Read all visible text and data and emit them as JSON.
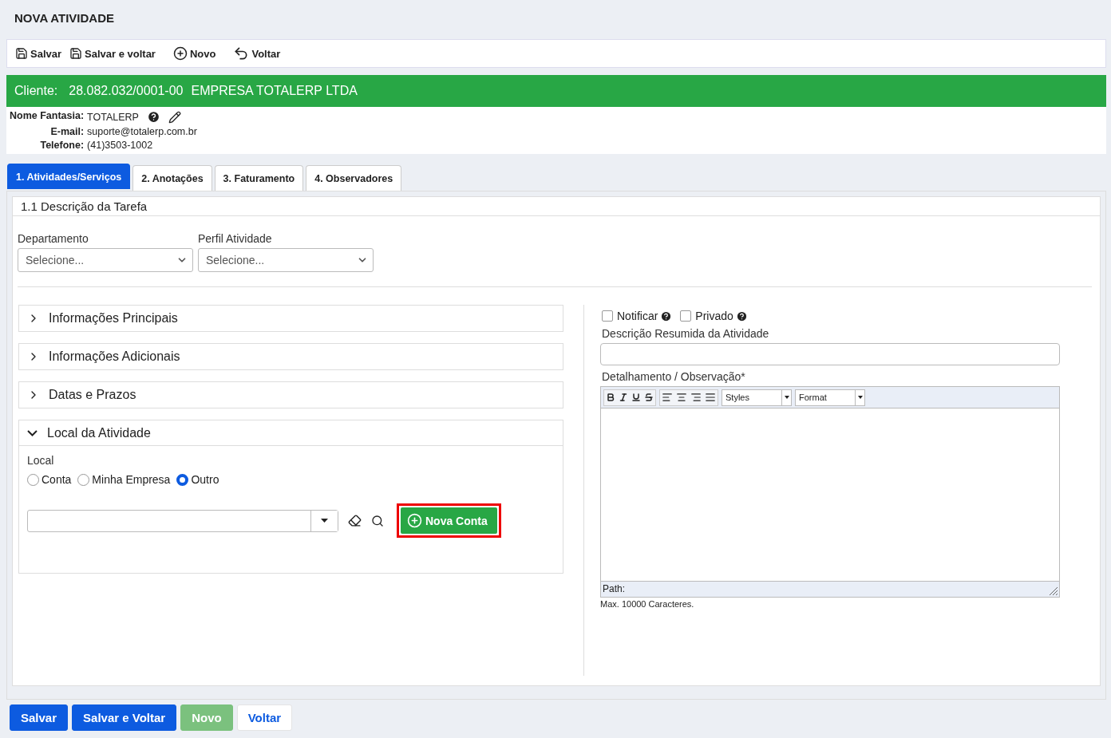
{
  "page_title": "NOVA ATIVIDADE",
  "toolbar": [
    {
      "label": "Salvar",
      "kind": "save"
    },
    {
      "label": "Salvar e voltar",
      "kind": "save"
    },
    {
      "label": "Novo",
      "kind": "new"
    },
    {
      "label": "Voltar",
      "kind": "back"
    }
  ],
  "client": {
    "label": "Cliente:",
    "document": "28.082.032/0001-00",
    "name": "EMPRESA TOTALERP LTDA"
  },
  "details": [
    {
      "label": "Nome Fantasia:",
      "value": "TOTALERP",
      "kind": "editable"
    },
    {
      "label": "E-mail:",
      "value": "suporte@totalerp.com.br",
      "kind": "plain"
    },
    {
      "label": "Telefone:",
      "value": "(41)3503-1002",
      "kind": "plain"
    }
  ],
  "tabs": [
    {
      "label": "1. Atividades/Serviços",
      "selected": true
    },
    {
      "label": "2. Anotações",
      "selected": false
    },
    {
      "label": "3. Faturamento",
      "selected": false
    },
    {
      "label": "4. Observadores",
      "selected": false
    }
  ],
  "section_title": "1.1 Descrição da Tarefa",
  "selects": [
    {
      "label": "Departamento",
      "value": "Selecione..."
    },
    {
      "label": "Perfil Atividade",
      "value": "Selecione..."
    }
  ],
  "accordions": [
    {
      "title": "Informações Principais",
      "expanded": false
    },
    {
      "title": "Informações Adicionais",
      "expanded": false
    },
    {
      "title": "Datas e Prazos",
      "expanded": false
    },
    {
      "title": "Local da Atividade",
      "expanded": true
    }
  ],
  "local": {
    "label": "Local",
    "options": [
      {
        "label": "Conta",
        "selected": false
      },
      {
        "label": "Minha Empresa",
        "selected": false
      },
      {
        "label": "Outro",
        "selected": true
      }
    ],
    "button": "Nova Conta"
  },
  "checkboxes": [
    {
      "label": "Notificar",
      "checked": false
    },
    {
      "label": "Privado",
      "checked": false
    }
  ],
  "summary_label": "Descrição Resumida da Atividade",
  "detail_label": "Detalhamento / Observação*",
  "editor": {
    "styles": "Styles",
    "format": "Format",
    "path": "Path:",
    "note": "Max. 10000 Caracteres."
  },
  "footer_buttons": [
    {
      "label": "Salvar",
      "kind": "primary"
    },
    {
      "label": "Salvar e Voltar",
      "kind": "primary"
    },
    {
      "label": "Novo",
      "kind": "disabled"
    },
    {
      "label": "Voltar",
      "kind": "light"
    }
  ]
}
